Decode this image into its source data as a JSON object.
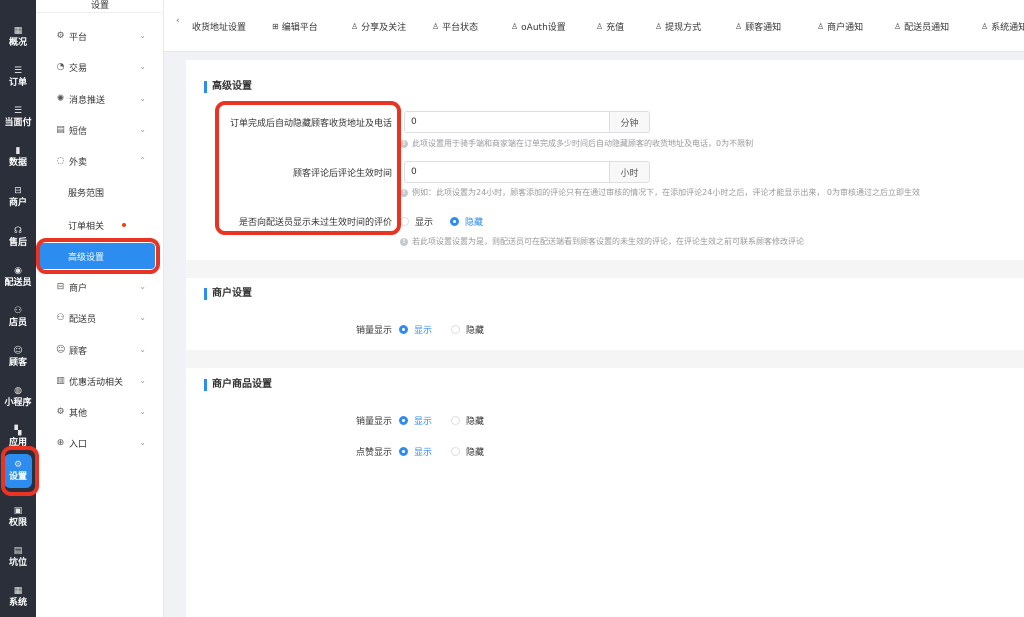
{
  "rail": [
    {
      "label": "概况",
      "icon": "grid-icon",
      "glyph": "▦"
    },
    {
      "label": "订单",
      "icon": "list-icon",
      "glyph": "☰"
    },
    {
      "label": "当面付",
      "icon": "list-icon",
      "glyph": "☰"
    },
    {
      "label": "数据",
      "icon": "bar-chart-icon",
      "glyph": "▮"
    },
    {
      "label": "商户",
      "icon": "store-icon",
      "glyph": "⊟"
    },
    {
      "label": "售后",
      "icon": "headset-icon",
      "glyph": "☊"
    },
    {
      "label": "配送员",
      "icon": "scooter-icon",
      "glyph": "◉"
    },
    {
      "label": "店员",
      "icon": "users-icon",
      "glyph": "⚇"
    },
    {
      "label": "顾客",
      "icon": "user-circle-icon",
      "glyph": "☺"
    },
    {
      "label": "小程序",
      "icon": "wechat-icon",
      "glyph": "◍"
    },
    {
      "label": "应用",
      "icon": "apps-icon",
      "glyph": "▚"
    },
    {
      "label": "设置",
      "icon": "settings-user-icon",
      "glyph": "⚙",
      "active": true
    },
    {
      "label": "权限",
      "icon": "lock-icon",
      "glyph": "▣"
    },
    {
      "label": "坑位",
      "icon": "document-icon",
      "glyph": "▤"
    },
    {
      "label": "系统",
      "icon": "windows-icon",
      "glyph": "▦"
    }
  ],
  "submenu": {
    "title": "设置",
    "items": [
      {
        "label": "平台",
        "icon": "gear-icon",
        "glyph": "⚙",
        "chevron": "down"
      },
      {
        "label": "交易",
        "icon": "pie-icon",
        "glyph": "◔",
        "chevron": "down"
      },
      {
        "label": "消息推送",
        "icon": "broadcast-icon",
        "glyph": "✺",
        "chevron": "down"
      },
      {
        "label": "短信",
        "icon": "sms-icon",
        "glyph": "▤",
        "chevron": "down"
      },
      {
        "label": "外卖",
        "icon": "takeout-icon",
        "glyph": "◌",
        "chevron": "up"
      },
      {
        "label": "服务范围",
        "sub": true
      },
      {
        "label": "订单相关",
        "sub": true,
        "dot": true
      },
      {
        "label": "高级设置",
        "sub": true,
        "active": true
      },
      {
        "label": "商户",
        "icon": "store-icon",
        "glyph": "⊟",
        "chevron": "down"
      },
      {
        "label": "配送员",
        "icon": "rider-icon",
        "glyph": "⚇",
        "chevron": "down"
      },
      {
        "label": "顾客",
        "icon": "user-icon",
        "glyph": "☺",
        "chevron": "down"
      },
      {
        "label": "优惠活动相关",
        "icon": "gift-icon",
        "glyph": "▥",
        "chevron": "down"
      },
      {
        "label": "其他",
        "icon": "settings-icon",
        "glyph": "⚙",
        "chevron": "down"
      },
      {
        "label": "入口",
        "icon": "entry-icon",
        "glyph": "⊕",
        "chevron": "down"
      }
    ]
  },
  "tabs": [
    {
      "label": "收货地址设置",
      "icon": ""
    },
    {
      "label": "编辑平台",
      "icon": "edit-grid-icon",
      "glyph": "⊞"
    },
    {
      "label": "分享及关注",
      "icon": "user-share-icon",
      "glyph": "♙"
    },
    {
      "label": "平台状态",
      "icon": "user-status-icon",
      "glyph": "♙"
    },
    {
      "label": "oAuth设置",
      "icon": "oauth-icon",
      "glyph": "♙"
    },
    {
      "label": "充值",
      "icon": "recharge-icon",
      "glyph": "♙"
    },
    {
      "label": "提现方式",
      "icon": "withdraw-icon",
      "glyph": "♙"
    },
    {
      "label": "顾客通知",
      "icon": "customer-notify-icon",
      "glyph": "♙"
    },
    {
      "label": "商户通知",
      "icon": "merchant-notify-icon",
      "glyph": "♙"
    },
    {
      "label": "配送员通知",
      "icon": "rider-notify-icon",
      "glyph": "♙"
    },
    {
      "label": "系统通知",
      "icon": "system-notify-icon",
      "glyph": "♙"
    }
  ],
  "advanced": {
    "title": "高级设置",
    "hide_address_label": "订单完成后自动隐藏顾客收货地址及电话",
    "hide_address_value": "0",
    "hide_address_unit": "分钟",
    "hide_address_hint": "此项设置用于骑手端和商家端在订单完成多少时间后自动隐藏顾客的收货地址及电话，0为不限制",
    "review_label": "顾客评论后评论生效时间",
    "review_value": "0",
    "review_unit": "小时",
    "review_hint": "例如：此项设置为24小时，顾客添加的评论只有在通过审核的情况下，在添加评论24小时之后，评论才能显示出来，  0为审核通过之后立即生效",
    "show_rider_label": "是否向配送员显示未过生效时间的评价",
    "show_option": "显示",
    "hide_option": "隐藏",
    "show_rider_hint": "若此项设置设置为是，则配送员可在配送端看到顾客设置的未生效的评论，在评论生效之前可联系顾客修改评论"
  },
  "merchant": {
    "title": "商户设置",
    "sales_label": "销量显示",
    "show_option": "显示",
    "hide_option": "隐藏"
  },
  "merchant_goods": {
    "title": "商户商品设置",
    "sales_label": "销量显示",
    "like_label": "点赞显示",
    "show_option": "显示",
    "hide_option": "隐藏"
  },
  "colors": {
    "accent": "#2d8cf0",
    "annotation": "#ea3323",
    "rail_bg": "#2b2f3a"
  }
}
